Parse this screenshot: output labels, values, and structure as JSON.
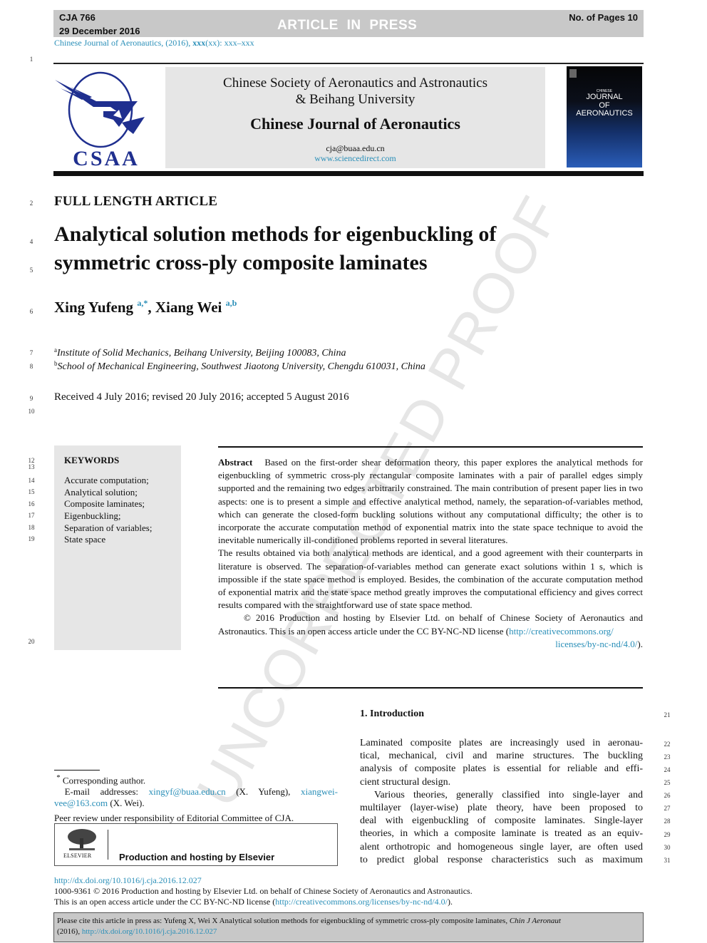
{
  "header": {
    "manuscript_id": "CJA 766",
    "date": "29 December 2016",
    "status": "ARTICLE  IN  PRESS",
    "page_count": "No. of Pages 10",
    "citation": "Chinese Journal of Aeronautics, (2016), ",
    "citation_volume": "xxx",
    "citation_issue_pages": "(xx): xxx–xxx"
  },
  "masthead": {
    "logo_text": "CSAA",
    "society_line1": "Chinese Society of Aeronautics and Astronautics",
    "society_line2": "& Beihang University",
    "journal_name": "Chinese Journal of Aeronautics",
    "email": "cja@buaa.edu.cn",
    "website": "www.sciencedirect.com",
    "cover": {
      "kicker": "CHINESE",
      "title_line1": "JOURNAL",
      "title_line2": "OF",
      "title_line3": "AERONAUTICS"
    }
  },
  "article": {
    "type": "FULL LENGTH ARTICLE",
    "title_line1": "Analytical solution methods for eigenbuckling of",
    "title_line2": "symmetric cross-ply composite laminates",
    "authors": [
      {
        "name": "Xing Yufeng",
        "affil": "a,*"
      },
      {
        "name": "Xiang Wei",
        "affil": "a,b"
      }
    ],
    "affiliations": [
      {
        "mark": "a",
        "text": "Institute of Solid Mechanics, Beihang University, Beijing 100083, China"
      },
      {
        "mark": "b",
        "text": "School of Mechanical Engineering, Southwest Jiaotong University, Chengdu 610031, China"
      }
    ],
    "received": "Received 4 July 2016; revised 20 July 2016; accepted 5 August 2016"
  },
  "keywords": {
    "heading": "KEYWORDS",
    "items": [
      "Accurate computation;",
      "Analytical solution;",
      "Composite laminates;",
      "Eigenbuckling;",
      "Separation of variables;",
      "State space"
    ]
  },
  "abstract": {
    "label": "Abstract",
    "para1": "Based on the first-order shear deformation theory, this paper explores the analytical methods for eigenbuckling of symmetric cross-ply rectangular composite laminates with a pair of parallel edges simply supported and the remaining two edges arbitrarily constrained. The main contribution of present paper lies in two aspects: one is to present a simple and effective analytical method, namely, the separation-of-variables method, which can generate the closed-form buckling solutions without any computational difficulty; the other is to incorporate the accurate computation method of exponential matrix into the state space technique to avoid the inevitable numerically ill-conditioned problems reported in several literatures.",
    "para2": "The results obtained via both analytical methods are identical, and a good agreement with their counterparts in literature is observed. The separation-of-variables method can generate exact solutions within 1 s, which is impossible if the state space method is employed. Besides, the combination of the accurate computation method of exponential matrix and the state space method greatly improves the computational efficiency and gives correct results compared with the straightforward use of state space method.",
    "copyright": "© 2016 Production and hosting by Elsevier Ltd. on behalf of Chinese Society of Aeronautics and Astronautics. This is an open access article under the CC BY-NC-ND license (",
    "license_url_part1": "http://creativecommons.org/",
    "license_url_part2": "licenses/by-nc-nd/4.0/",
    "license_close": ")."
  },
  "introduction": {
    "heading": "1. Introduction",
    "lines": [
      "Laminated composite plates are increasingly used in aeronau-",
      "tical, mechanical, civil and marine structures. The buckling",
      "analysis of composite plates is essential for reliable and effi-",
      "cient structural design.",
      "Various theories, generally classified into single-layer and",
      "multilayer (layer-wise) plate theory, have been proposed to",
      "deal with eigenbuckling of composite laminates. Single-layer",
      "theories, in which a composite laminate is treated as an equiv-",
      "alent orthotropic and homogeneous single layer, are often used",
      "to predict global response characteristics such as maximum"
    ]
  },
  "footnotes": {
    "corresponding_mark": "*",
    "corresponding": "Corresponding author.",
    "email_label": "E-mail addresses: ",
    "email1": "xingyf@buaa.edu.cn",
    "email1_owner": " (X. Yufeng), ",
    "email2": "xiangwei-vee@163.com",
    "email2_owner": " (X. Wei).",
    "peer_review": "Peer review under responsibility of Editorial Committee of CJA.",
    "elsevier_logo_label": "ELSEVIER",
    "elsevier_text": "Production and hosting by Elsevier"
  },
  "bottom": {
    "doi": "http://dx.doi.org/10.1016/j.cja.2016.12.027",
    "issn_line": "1000-9361 © 2016 Production and hosting by Elsevier Ltd. on behalf of Chinese Society of Aeronautics and Astronautics.",
    "oa_prefix": "This is an open access article under the CC BY-NC-ND license (",
    "oa_url": "http://creativecommons.org/licenses/by-nc-nd/4.0/",
    "oa_suffix": ").",
    "cite_prefix": "Please cite this article in press as: Yufeng X, Wei X Analytical solution methods for eigenbuckling of symmetric cross-ply composite laminates, ",
    "cite_journal": "Chin J Aeronaut",
    "cite_year": "(2016), ",
    "cite_doi": "http://dx.doi.org/10.1016/j.cja.2016.12.027"
  },
  "watermark": "UNCORRECTED PROOF",
  "line_numbers": [
    "1",
    "2",
    "4",
    "5",
    "6",
    "7",
    "8",
    "9",
    "10",
    "12",
    "13",
    "14",
    "15",
    "16",
    "17",
    "18",
    "19",
    "20",
    "21",
    "22",
    "23",
    "24",
    "25",
    "26",
    "27",
    "28",
    "29",
    "30",
    "31"
  ],
  "colors": {
    "link": "#2a8fb8",
    "logo_blue": "#1f2f8f",
    "header_bar": "#c8c8c8",
    "panel": "#e6e6e6"
  }
}
